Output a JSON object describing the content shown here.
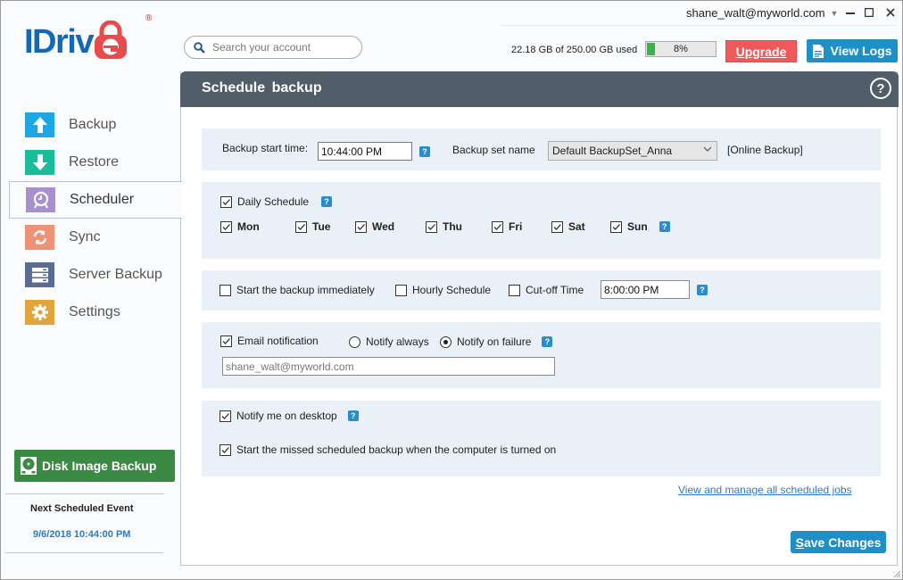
{
  "header": {
    "logo_text": "IDriv",
    "logo_reg": "®",
    "account": "shane_walt@myworld.com",
    "search_placeholder": "Search your account",
    "usage_text": "22.18 GB of 250.00 GB used",
    "usage_percent": 8,
    "usage_percent_label": "8%",
    "upgrade_label": "Upgrade",
    "view_logs_label": "View Logs",
    "colors": {
      "brand_blue": "#1468b5",
      "brand_red": "#e84b4b",
      "upgrade": "#f0585a",
      "accent": "#1f8fc7"
    }
  },
  "sidebar": {
    "items": [
      {
        "label": "Backup",
        "icon": "upload-arrow-icon",
        "color": "#1ea7e1"
      },
      {
        "label": "Restore",
        "icon": "download-arrow-icon",
        "color": "#1bbc9b"
      },
      {
        "label": "Scheduler",
        "icon": "clock-icon",
        "color": "#a98fd1",
        "active": true
      },
      {
        "label": "Sync",
        "icon": "sync-icon",
        "color": "#ef9175"
      },
      {
        "label": "Server Backup",
        "icon": "server-icon",
        "color": "#5b6c93"
      },
      {
        "label": "Settings",
        "icon": "gear-icon",
        "color": "#e0a53c"
      }
    ],
    "disk_image_label": "Disk Image Backup",
    "next_event_label": "Next Scheduled Event",
    "next_event_value": "9/6/2018 10:44:00 PM"
  },
  "main": {
    "title": "Schedule backup",
    "backup_start_label": "Backup start time:",
    "backup_start_value": "10:44:00 PM",
    "backup_set_label": "Backup set name",
    "backup_set_value": "Default BackupSet_Anna",
    "backup_type": "[Online Backup]",
    "daily_schedule": {
      "label": "Daily Schedule",
      "checked": true
    },
    "days": [
      {
        "label": "Mon",
        "checked": true
      },
      {
        "label": "Tue",
        "checked": true
      },
      {
        "label": "Wed",
        "checked": true
      },
      {
        "label": "Thu",
        "checked": true
      },
      {
        "label": "Fri",
        "checked": true
      },
      {
        "label": "Sat",
        "checked": true
      },
      {
        "label": "Sun",
        "checked": true
      }
    ],
    "start_immediately": {
      "label": "Start the backup immediately",
      "checked": false
    },
    "hourly_schedule": {
      "label": "Hourly Schedule",
      "checked": false
    },
    "cutoff_time": {
      "label": "Cut-off Time",
      "checked": false,
      "value": "8:00:00 PM"
    },
    "email_notification": {
      "label": "Email notification",
      "checked": true
    },
    "notify_always": {
      "label": "Notify always",
      "selected": false
    },
    "notify_failure": {
      "label": "Notify on failure",
      "selected": true
    },
    "email_value": "shane_walt@myworld.com",
    "notify_desktop": {
      "label": "Notify me on desktop",
      "checked": true
    },
    "missed_backup": {
      "label": "Start the missed scheduled backup when the computer is turned on",
      "checked": true
    },
    "manage_link": "View and manage all scheduled jobs",
    "save_label_first": "S",
    "save_label_rest": "ave Changes",
    "help_glyph": "?"
  }
}
